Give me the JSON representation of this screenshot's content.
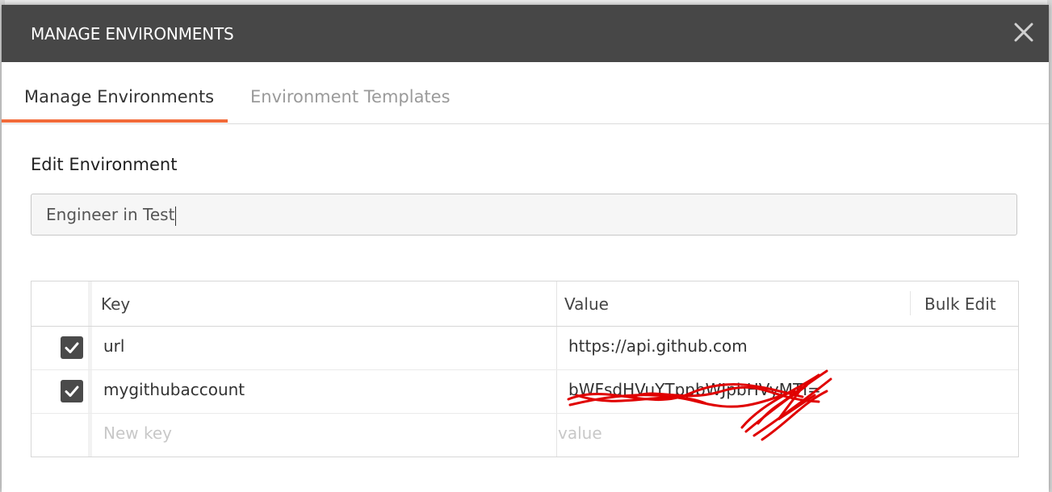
{
  "modal": {
    "title": "MANAGE ENVIRONMENTS"
  },
  "tabs": [
    {
      "label": "Manage Environments",
      "active": true
    },
    {
      "label": "Environment Templates",
      "active": false
    }
  ],
  "edit": {
    "section_title": "Edit Environment",
    "environment_name": "Engineer in Test"
  },
  "table": {
    "headers": {
      "key": "Key",
      "value": "Value",
      "bulk_edit": "Bulk Edit"
    },
    "rows": [
      {
        "checked": true,
        "key": "url",
        "value": "https://api.github.com"
      },
      {
        "checked": true,
        "key": "mygithubaccount",
        "value": "bWFsdHVuYTppbWJpbHVyMTI="
      }
    ],
    "new_row": {
      "key_placeholder": "New key",
      "value_placeholder": "value"
    }
  },
  "colors": {
    "accent": "#f26b3a",
    "header_bg": "#474747",
    "checkbox_bg": "#4a4a4a",
    "redaction": "#e00000"
  },
  "icons": {
    "close": "close-icon",
    "check": "check-icon"
  }
}
